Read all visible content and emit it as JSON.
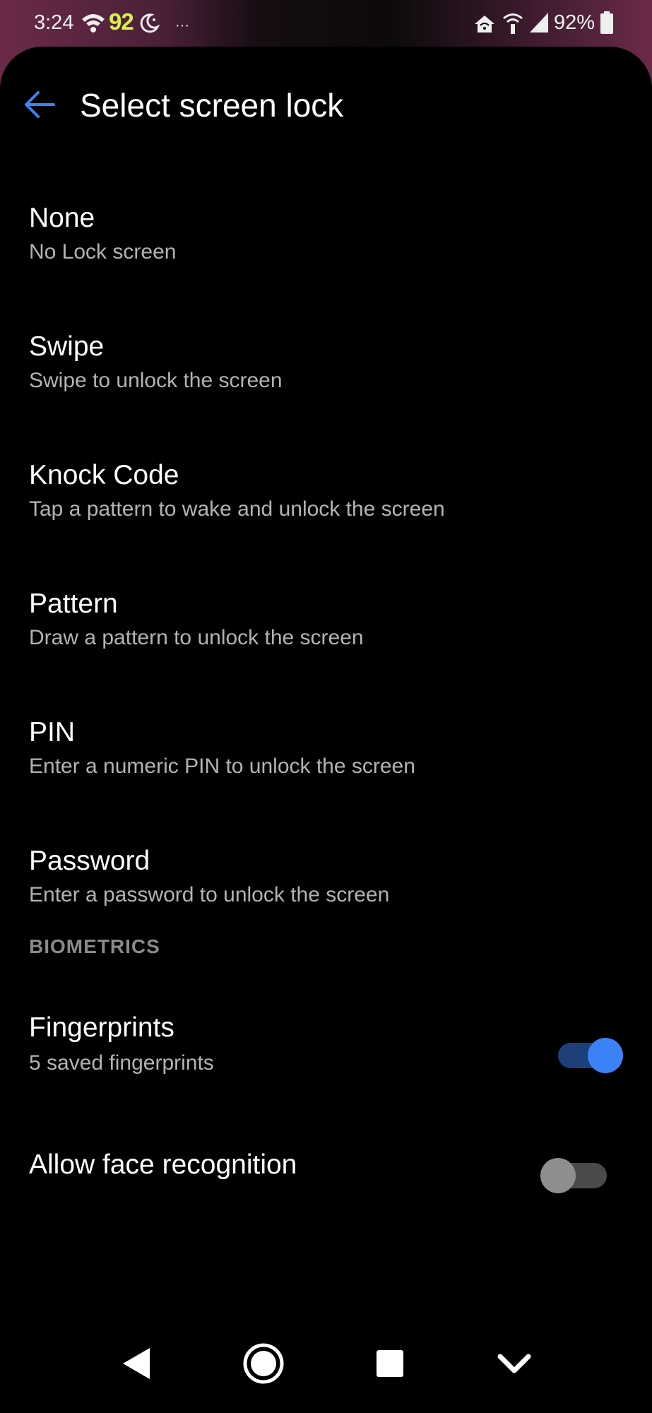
{
  "status_bar": {
    "time": "3:24",
    "badge": "92",
    "more": "···",
    "battery_percent": "92%",
    "icons": [
      "wifi-icon",
      "moon-icon",
      "hotspot-icon",
      "wifi-calling-icon",
      "signal-icon",
      "battery-icon"
    ]
  },
  "header": {
    "title": "Select screen lock",
    "back_icon": "arrow-left-icon",
    "accent_color": "#3b82f6"
  },
  "lock_options": [
    {
      "title": "None",
      "subtitle": "No Lock screen"
    },
    {
      "title": "Swipe",
      "subtitle": "Swipe to unlock the screen"
    },
    {
      "title": "Knock Code",
      "subtitle": "Tap a pattern to wake and unlock the screen"
    },
    {
      "title": "Pattern",
      "subtitle": "Draw a pattern to unlock the screen"
    },
    {
      "title": "PIN",
      "subtitle": "Enter a numeric PIN to unlock the screen"
    },
    {
      "title": "Password",
      "subtitle": "Enter a password to unlock the screen"
    }
  ],
  "biometrics": {
    "header": "BIOMETRICS",
    "fingerprints": {
      "title": "Fingerprints",
      "subtitle": "5 saved fingerprints",
      "enabled": true
    },
    "face": {
      "title": "Allow face recognition",
      "enabled": false
    }
  },
  "nav_bar": {
    "icons": [
      "back-triangle-icon",
      "home-circle-icon",
      "recents-square-icon",
      "chevron-down-icon"
    ]
  }
}
